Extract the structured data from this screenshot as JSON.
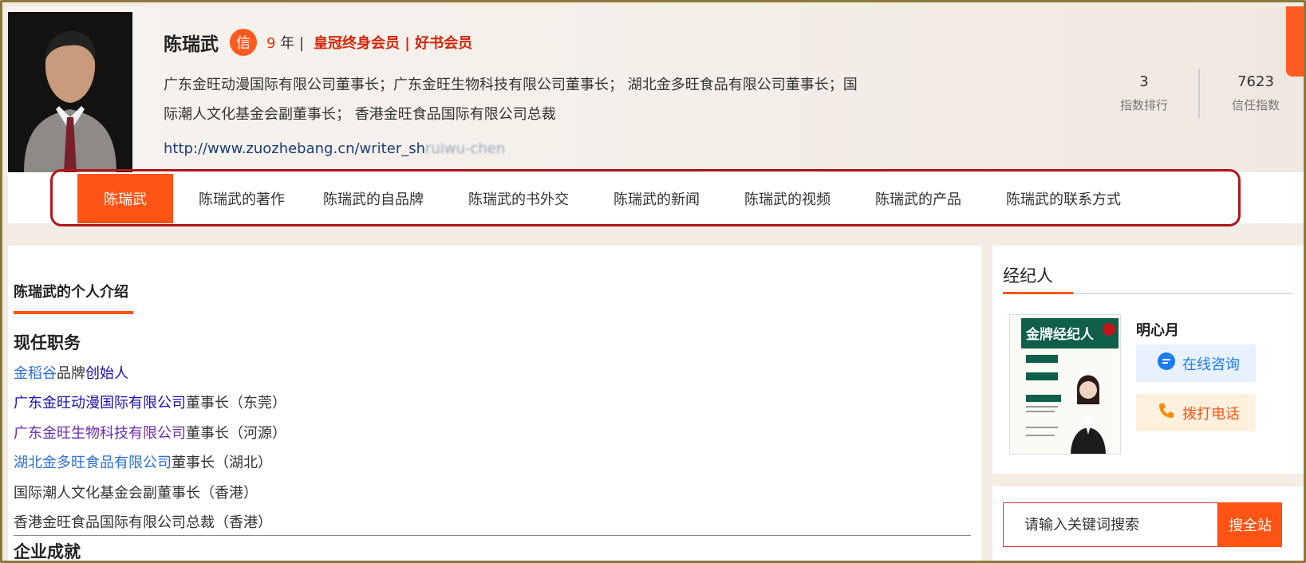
{
  "profile": {
    "name": "陈瑞武",
    "badge": "信",
    "years_num": "9",
    "years_unit": "年 |",
    "membership": "皇冠终身会员 | 好书会员",
    "bio": "广东金旺动漫国际有限公司董事长；广东金旺生物科技有限公司董事长； 湖北金多旺食品有限公司董事长；国际潮人文化基金会副董事长； 香港金旺食品国际有限公司总裁",
    "url": "http://www.zuozhebang.cn/writer_sh",
    "url_blurred": "ruiwu-chen",
    "stats": [
      {
        "value": "3",
        "label": "指数排行"
      },
      {
        "value": "7623",
        "label": "信任指数"
      }
    ]
  },
  "nav": {
    "items": [
      "陈瑞武",
      "陈瑞武的著作",
      "陈瑞武的自品牌",
      "陈瑞武的书外交",
      "陈瑞武的新闻",
      "陈瑞武的视频",
      "陈瑞武的产品",
      "陈瑞武的联系方式"
    ],
    "active_index": 0
  },
  "intro": {
    "title": "陈瑞武的个人介绍",
    "current_heading": "现任职务",
    "jobs": [
      {
        "link": "金稻谷",
        "mid": "品牌",
        "link2": "创始人",
        "rest": ""
      },
      {
        "link": "广东金旺动漫国际有限公司",
        "rest": "董事长（东莞）"
      },
      {
        "link": "广东金旺生物科技有限公司",
        "rest": "董事长（河源）"
      },
      {
        "link": "湖北金多旺食品有限公司",
        "rest": "董事长（湖北）"
      },
      {
        "link": "",
        "rest": "国际潮人文化基金会副董事长（香港）"
      },
      {
        "link": "",
        "rest": "香港金旺食品国际有限公司总裁（香港）"
      }
    ],
    "achievements_heading": "企业成就"
  },
  "agent": {
    "title": "经纪人",
    "name": "明心月",
    "poster_title": "金牌经纪人",
    "consult_label": "在线咨询",
    "call_label": "拨打电话"
  },
  "search": {
    "placeholder": "请输入关键词搜索",
    "button_label": "搜全站"
  },
  "colors": {
    "accent": "#ff5414",
    "annotation": "#b0151a"
  }
}
